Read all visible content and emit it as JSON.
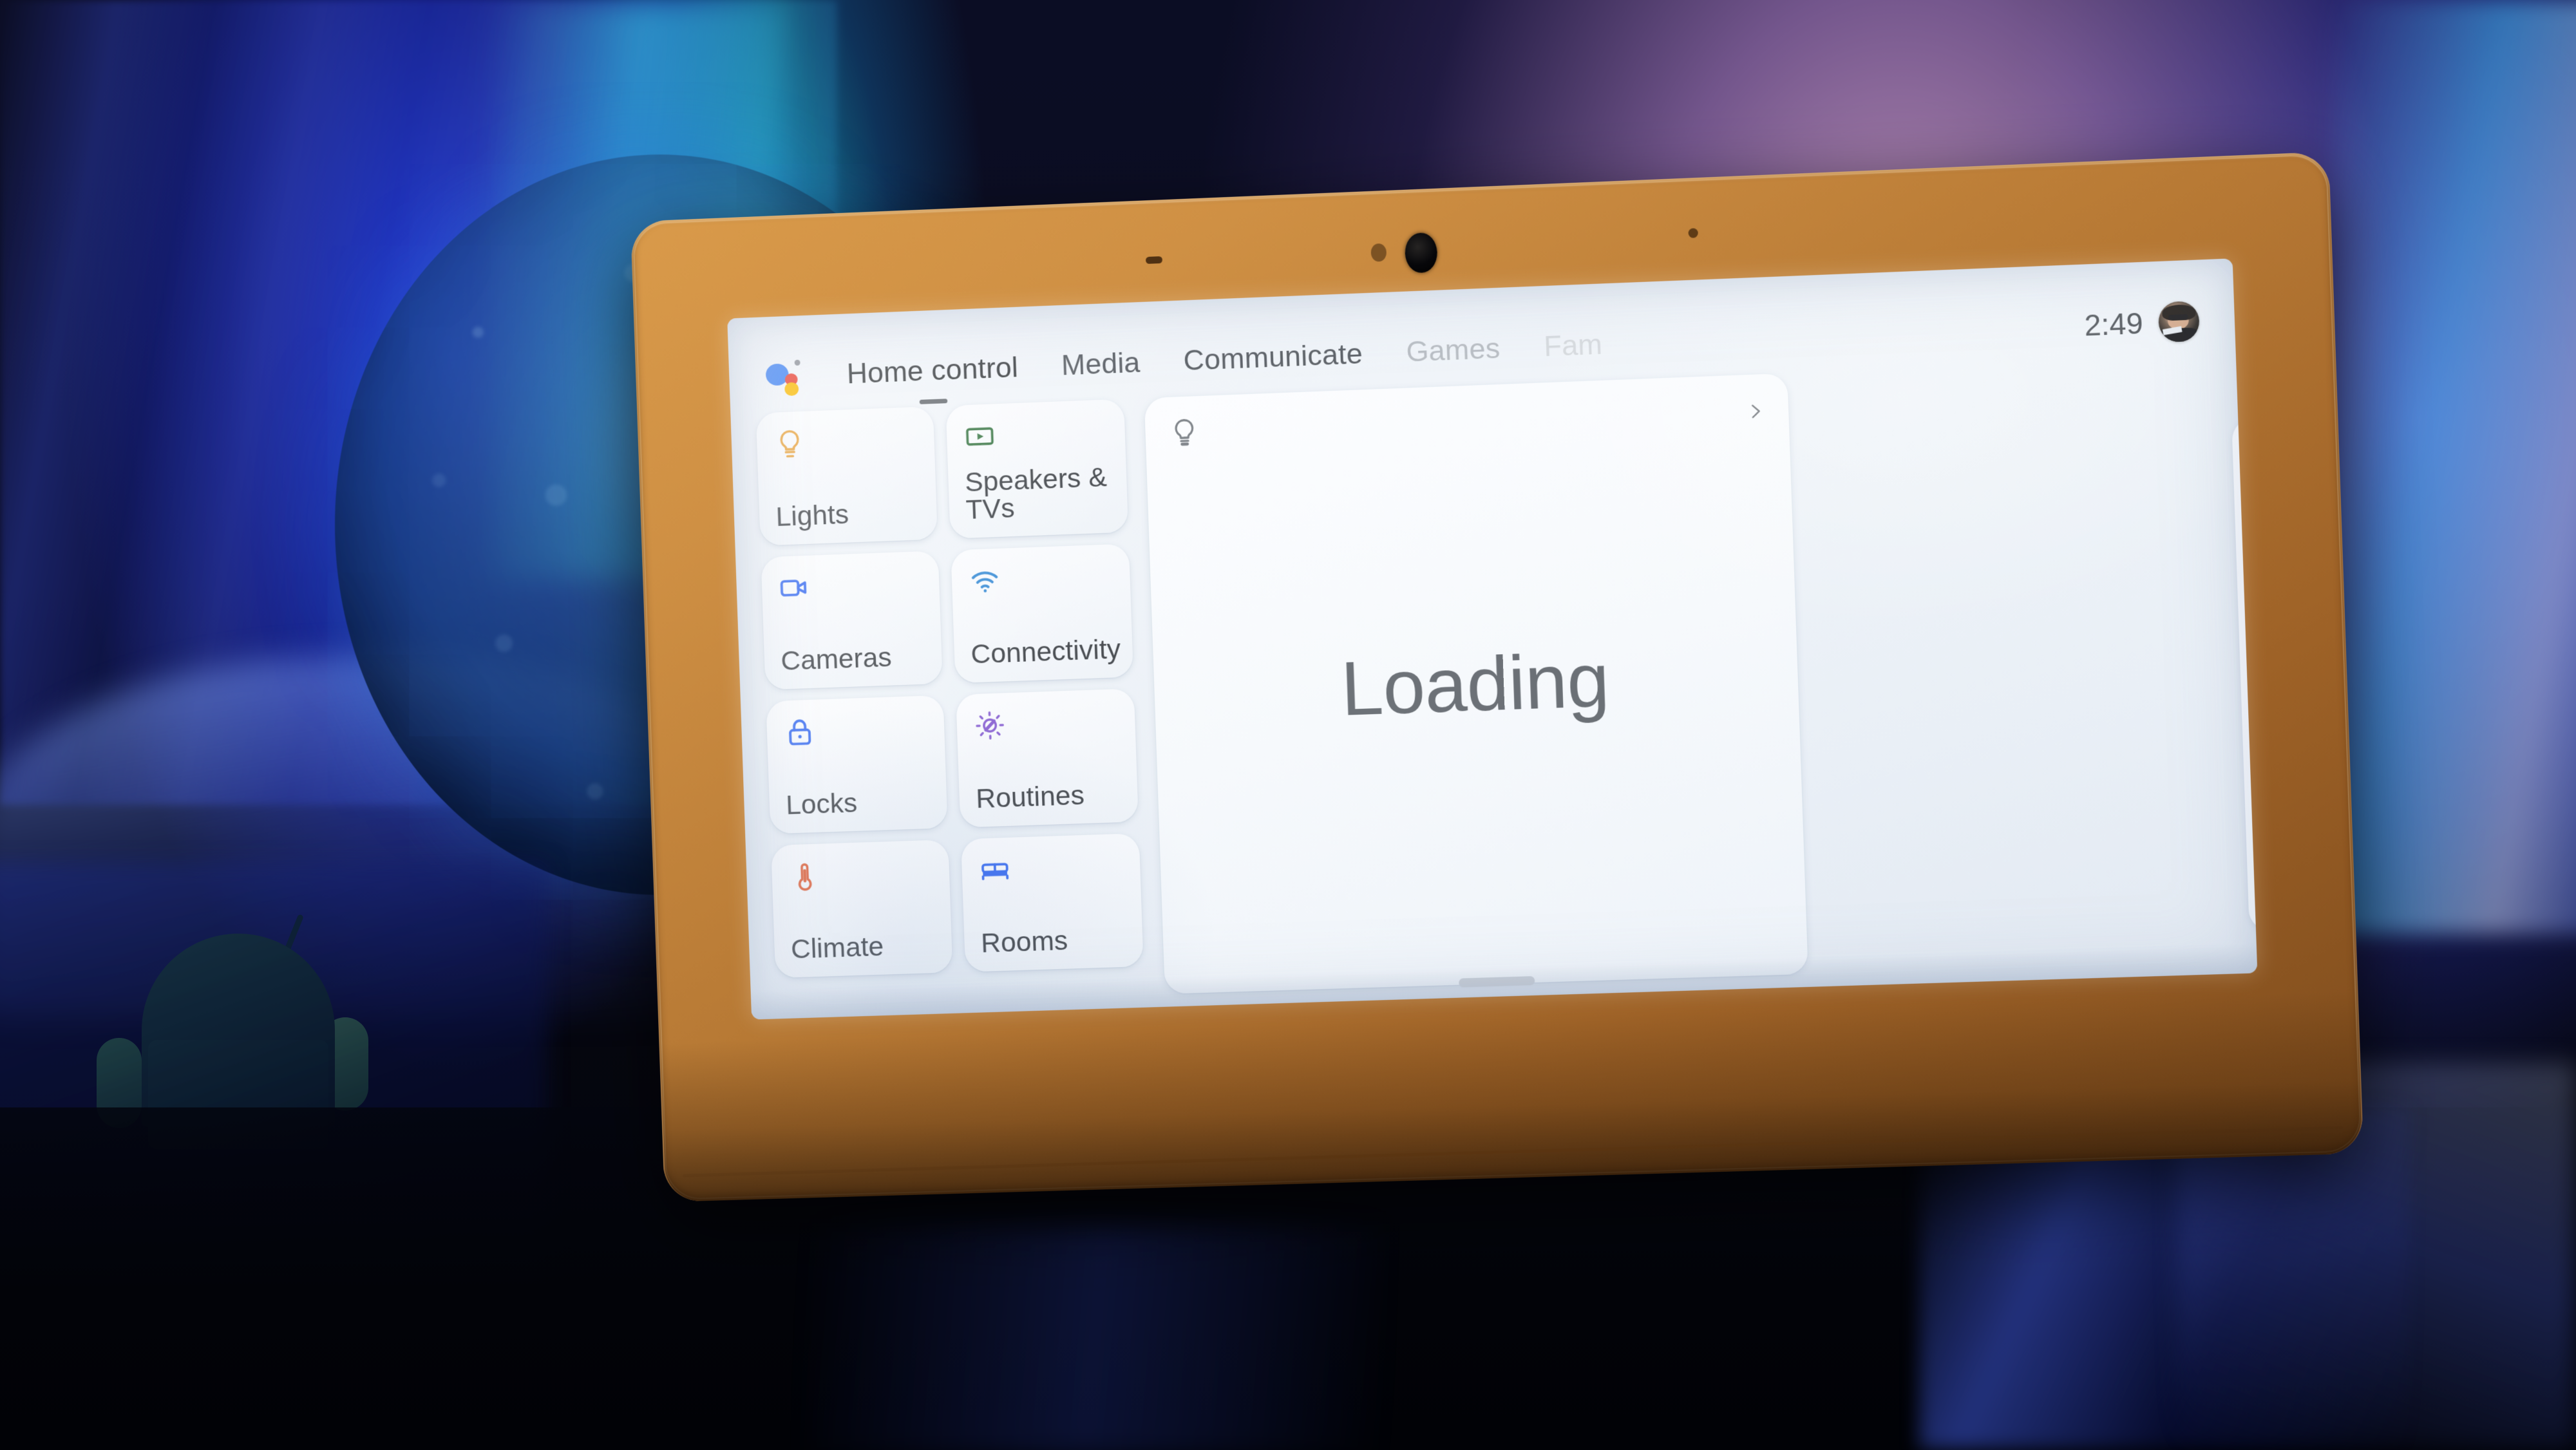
{
  "device": {
    "name": "Google Nest Hub Max smart display",
    "bezel_color": "#b87a35",
    "screen_background": "#eef3f8"
  },
  "header": {
    "assistant_logo_name": "google-assistant-logo",
    "logo_colors": {
      "blue": "#4285F4",
      "red": "#EA4335",
      "yellow": "#FBBC05",
      "grey": "#8d9299"
    },
    "tabs": [
      {
        "label": "Home control",
        "state": "active"
      },
      {
        "label": "Media",
        "state": "inactive"
      },
      {
        "label": "Communicate",
        "state": "inactive"
      },
      {
        "label": "Games",
        "state": "dim"
      },
      {
        "label": "Fam",
        "state": "fading"
      }
    ],
    "clock": "2:49",
    "avatar_alt": "user profile photo"
  },
  "tiles": {
    "column_1": [
      {
        "label": "Lights",
        "icon": "lightbulb-icon",
        "icon_color": "#E8A33D"
      },
      {
        "label": "Cameras",
        "icon": "video-camera-icon",
        "icon_color": "#3B6EF0"
      },
      {
        "label": "Locks",
        "icon": "padlock-icon",
        "icon_color": "#3B6EF0"
      },
      {
        "label": "Climate",
        "icon": "thermometer-icon",
        "icon_color": "#E2643C"
      }
    ],
    "column_2": [
      {
        "label": "Speakers & TVs",
        "icon": "play-box-icon",
        "icon_color": "#3F7A4A"
      },
      {
        "label": "Connectivity",
        "icon": "wifi-icon",
        "icon_color": "#3D8ED6"
      },
      {
        "label": "Routines",
        "icon": "brightness-icon",
        "icon_color": "#8A63D2"
      },
      {
        "label": "Rooms",
        "icon": "bed-icon",
        "icon_color": "#3B6EF0"
      }
    ]
  },
  "panel": {
    "icon": "lightbulb-outline-icon",
    "icon_color": "#7c8187",
    "chevron": "chevron-right-icon",
    "status_text": "Loading"
  },
  "system": {
    "home_indicator": "home-indicator-pill"
  },
  "scene": {
    "moon_lamp": "blue-moon-lamp",
    "android_figurine": "android-mascot-figurine",
    "curtain": "blue-lit-curtain",
    "blanket": "blue-lit-blanket"
  }
}
